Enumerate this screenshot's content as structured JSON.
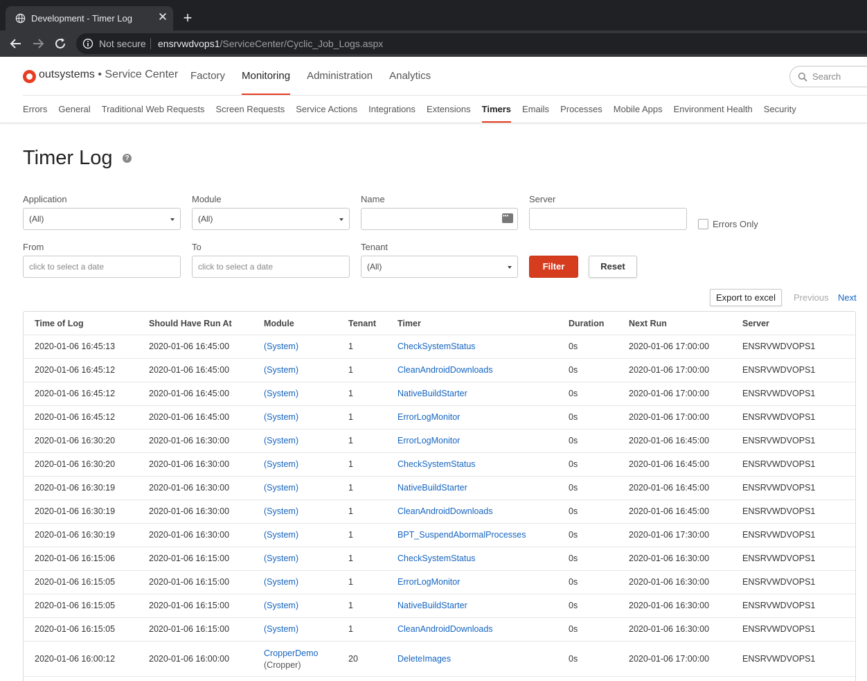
{
  "browser": {
    "tab_title": "Development - Timer Log",
    "new_tab": "+",
    "close": "✕",
    "not_secure": "Not secure",
    "url_host": "ensrvwdvops1",
    "url_path": "/ServiceCenter/Cyclic_Job_Logs.aspx"
  },
  "header": {
    "brand": "outsystems",
    "brand_sep": " • ",
    "brand_sub": "Service Center",
    "main_nav": [
      "Factory",
      "Monitoring",
      "Administration",
      "Analytics"
    ],
    "main_nav_active": "Monitoring",
    "search_placeholder": "Search",
    "sub_nav": [
      "Errors",
      "General",
      "Traditional Web Requests",
      "Screen Requests",
      "Service Actions",
      "Integrations",
      "Extensions",
      "Timers",
      "Emails",
      "Processes",
      "Mobile Apps",
      "Environment Health",
      "Security"
    ],
    "sub_nav_active": "Timers",
    "accent_color": "#e83d20"
  },
  "page": {
    "title": "Timer Log",
    "help": "?"
  },
  "filters": {
    "application_label": "Application",
    "application_value": "(All)",
    "module_label": "Module",
    "module_value": "(All)",
    "name_label": "Name",
    "name_value": "",
    "server_label": "Server",
    "server_value": "",
    "errors_only_label": "Errors Only",
    "errors_only_checked": false,
    "from_label": "From",
    "from_placeholder": "click to select a date",
    "to_label": "To",
    "to_placeholder": "click to select a date",
    "tenant_label": "Tenant",
    "tenant_value": "(All)",
    "filter_button": "Filter",
    "reset_button": "Reset"
  },
  "actions": {
    "export": "Export to excel",
    "previous": "Previous",
    "next": "Next"
  },
  "table": {
    "columns": [
      "Time of Log",
      "Should Have Run At",
      "Module",
      "Tenant",
      "Timer",
      "Duration",
      "Next Run",
      "Server"
    ],
    "rows": [
      {
        "time": "2020-01-06 16:45:13",
        "should": "2020-01-06 16:45:00",
        "module": "(System)",
        "module2": "",
        "tenant": "1",
        "timer": "CheckSystemStatus",
        "duration": "0s",
        "next": "2020-01-06 17:00:00",
        "server": "ENSRVWDVOPS1"
      },
      {
        "time": "2020-01-06 16:45:12",
        "should": "2020-01-06 16:45:00",
        "module": "(System)",
        "module2": "",
        "tenant": "1",
        "timer": "CleanAndroidDownloads",
        "duration": "0s",
        "next": "2020-01-06 17:00:00",
        "server": "ENSRVWDVOPS1"
      },
      {
        "time": "2020-01-06 16:45:12",
        "should": "2020-01-06 16:45:00",
        "module": "(System)",
        "module2": "",
        "tenant": "1",
        "timer": "NativeBuildStarter",
        "duration": "0s",
        "next": "2020-01-06 17:00:00",
        "server": "ENSRVWDVOPS1"
      },
      {
        "time": "2020-01-06 16:45:12",
        "should": "2020-01-06 16:45:00",
        "module": "(System)",
        "module2": "",
        "tenant": "1",
        "timer": "ErrorLogMonitor",
        "duration": "0s",
        "next": "2020-01-06 17:00:00",
        "server": "ENSRVWDVOPS1"
      },
      {
        "time": "2020-01-06 16:30:20",
        "should": "2020-01-06 16:30:00",
        "module": "(System)",
        "module2": "",
        "tenant": "1",
        "timer": "ErrorLogMonitor",
        "duration": "0s",
        "next": "2020-01-06 16:45:00",
        "server": "ENSRVWDVOPS1"
      },
      {
        "time": "2020-01-06 16:30:20",
        "should": "2020-01-06 16:30:00",
        "module": "(System)",
        "module2": "",
        "tenant": "1",
        "timer": "CheckSystemStatus",
        "duration": "0s",
        "next": "2020-01-06 16:45:00",
        "server": "ENSRVWDVOPS1"
      },
      {
        "time": "2020-01-06 16:30:19",
        "should": "2020-01-06 16:30:00",
        "module": "(System)",
        "module2": "",
        "tenant": "1",
        "timer": "NativeBuildStarter",
        "duration": "0s",
        "next": "2020-01-06 16:45:00",
        "server": "ENSRVWDVOPS1"
      },
      {
        "time": "2020-01-06 16:30:19",
        "should": "2020-01-06 16:30:00",
        "module": "(System)",
        "module2": "",
        "tenant": "1",
        "timer": "CleanAndroidDownloads",
        "duration": "0s",
        "next": "2020-01-06 16:45:00",
        "server": "ENSRVWDVOPS1"
      },
      {
        "time": "2020-01-06 16:30:19",
        "should": "2020-01-06 16:30:00",
        "module": "(System)",
        "module2": "",
        "tenant": "1",
        "timer": "BPT_SuspendAbormalProcesses",
        "duration": "0s",
        "next": "2020-01-06 17:30:00",
        "server": "ENSRVWDVOPS1"
      },
      {
        "time": "2020-01-06 16:15:06",
        "should": "2020-01-06 16:15:00",
        "module": "(System)",
        "module2": "",
        "tenant": "1",
        "timer": "CheckSystemStatus",
        "duration": "0s",
        "next": "2020-01-06 16:30:00",
        "server": "ENSRVWDVOPS1"
      },
      {
        "time": "2020-01-06 16:15:05",
        "should": "2020-01-06 16:15:00",
        "module": "(System)",
        "module2": "",
        "tenant": "1",
        "timer": "ErrorLogMonitor",
        "duration": "0s",
        "next": "2020-01-06 16:30:00",
        "server": "ENSRVWDVOPS1"
      },
      {
        "time": "2020-01-06 16:15:05",
        "should": "2020-01-06 16:15:00",
        "module": "(System)",
        "module2": "",
        "tenant": "1",
        "timer": "NativeBuildStarter",
        "duration": "0s",
        "next": "2020-01-06 16:30:00",
        "server": "ENSRVWDVOPS1"
      },
      {
        "time": "2020-01-06 16:15:05",
        "should": "2020-01-06 16:15:00",
        "module": "(System)",
        "module2": "",
        "tenant": "1",
        "timer": "CleanAndroidDownloads",
        "duration": "0s",
        "next": "2020-01-06 16:30:00",
        "server": "ENSRVWDVOPS1"
      },
      {
        "time": "2020-01-06 16:00:12",
        "should": "2020-01-06 16:00:00",
        "module": "CropperDemo",
        "module2": "(Cropper)",
        "tenant": "20",
        "timer": "DeleteImages",
        "duration": "0s",
        "next": "2020-01-06 17:00:00",
        "server": "ENSRVWDVOPS1"
      }
    ]
  }
}
